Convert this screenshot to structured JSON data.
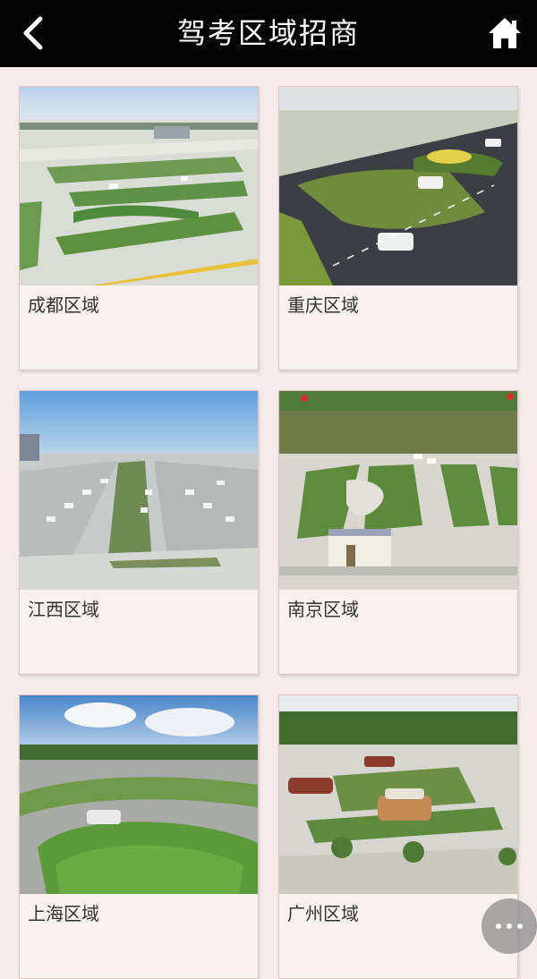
{
  "header": {
    "title": "驾考区域招商",
    "back_icon": "back-arrow-icon",
    "home_icon": "home-icon"
  },
  "regions": [
    {
      "label": "成都区域"
    },
    {
      "label": "重庆区域"
    },
    {
      "label": "江西区域"
    },
    {
      "label": "南京区域"
    },
    {
      "label": "上海区域"
    },
    {
      "label": "广州区域"
    }
  ],
  "floating": {
    "more_icon": "more-dots-icon"
  }
}
